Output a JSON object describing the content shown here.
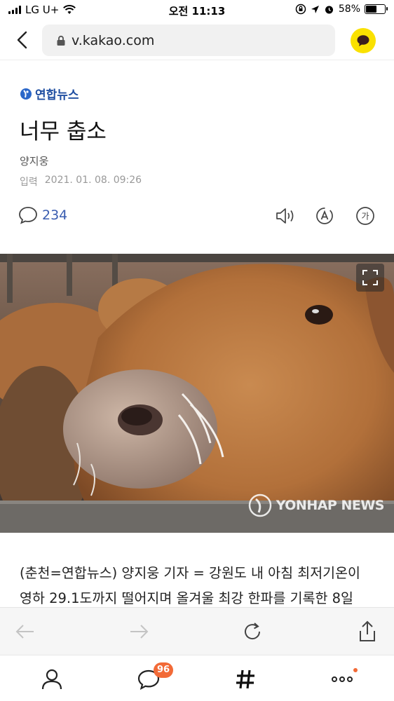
{
  "status_bar": {
    "carrier": "LG U+",
    "time": "오전 11:13",
    "battery": "58%"
  },
  "browser": {
    "url": "v.kakao.com"
  },
  "article": {
    "press": "연합뉴스",
    "title": "너무 춥소",
    "author": "양지웅",
    "date_label": "입력",
    "date": "2021. 01. 08. 09:26",
    "comment_count": "234",
    "photo_watermark": "YONHAP NEWS",
    "body_line1": "(춘천=연합뉴스) 양지웅 기자 = 강원도 내 아침 최저기온이",
    "body_line2": "영하 29.1도까지 떨어지며 올겨울 최강 한파를 기록한 8일"
  },
  "tool_icons": {
    "speaker": "speaker-icon",
    "translate": "translate-icon",
    "font_size": "가"
  },
  "tabbar": {
    "chat_badge": "96"
  },
  "colors": {
    "kakao_yellow": "#fae100",
    "comment_blue": "#3a5db0",
    "badge_orange": "#f26a37",
    "press_blue": "#1f4ea1"
  }
}
